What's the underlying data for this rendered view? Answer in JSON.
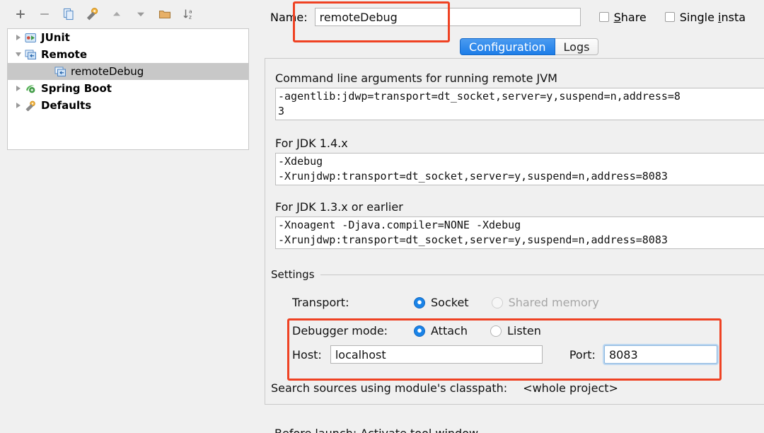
{
  "sidebar": {
    "toolbar": [
      {
        "name": "add-button",
        "icon": "plus-icon",
        "glyph": "+"
      },
      {
        "name": "remove-button",
        "icon": "minus-icon",
        "glyph": "−"
      },
      {
        "name": "copy-button",
        "icon": "copy-icon",
        "glyph": "copy"
      },
      {
        "name": "edit-defaults-button",
        "icon": "wrench-icon",
        "glyph": "wrench"
      },
      {
        "name": "move-up-button",
        "icon": "arrow-up-icon",
        "glyph": "▲"
      },
      {
        "name": "move-down-button",
        "icon": "arrow-down-icon",
        "glyph": "▼"
      },
      {
        "name": "new-folder-button",
        "icon": "folder-icon",
        "glyph": "folder"
      },
      {
        "name": "sort-alphabetically-button",
        "icon": "sort-az-icon",
        "glyph": "sort"
      }
    ],
    "tree": [
      {
        "label": "JUnit",
        "icon": "junit-icon",
        "expanded": false,
        "level": 1,
        "bold": true,
        "selected": false
      },
      {
        "label": "Remote",
        "icon": "remote-icon",
        "expanded": true,
        "level": 1,
        "bold": true,
        "selected": false
      },
      {
        "label": "remoteDebug",
        "icon": "remote-icon",
        "expanded": null,
        "level": 2,
        "bold": false,
        "selected": true
      },
      {
        "label": "Spring Boot",
        "icon": "spring-boot-icon",
        "expanded": false,
        "level": 1,
        "bold": true,
        "selected": false
      },
      {
        "label": "Defaults",
        "icon": "wrench-icon",
        "expanded": false,
        "level": 1,
        "bold": true,
        "selected": false
      }
    ]
  },
  "header": {
    "name_label": "Name:",
    "name_value": "remoteDebug",
    "name_placeholder": "",
    "share": {
      "label_pre": "",
      "label_mnemonic": "S",
      "label_post": "hare",
      "checked": false
    },
    "single_instance": {
      "label_pre": "Single ",
      "label_mnemonic": "i",
      "label_post": "nsta",
      "checked": false
    }
  },
  "tabs": [
    {
      "label": "Configuration",
      "active": true
    },
    {
      "label": "Logs",
      "active": false
    }
  ],
  "configuration": {
    "command_line": {
      "label": "Command line arguments for running remote JVM",
      "value": "-agentlib:jdwp=transport=dt_socket,server=y,suspend=n,address=8\n3"
    },
    "jdk14": {
      "label": "For JDK 1.4.x",
      "value": "-Xdebug\n-Xrunjdwp:transport=dt_socket,server=y,suspend=n,address=8083"
    },
    "jdk13": {
      "label": "For JDK 1.3.x or earlier",
      "value": "-Xnoagent -Djava.compiler=NONE -Xdebug\n-Xrunjdwp:transport=dt_socket,server=y,suspend=n,address=8083"
    },
    "settings": {
      "group_title": "Settings",
      "transport": {
        "label": "Transport:",
        "options": [
          {
            "label": "Socket",
            "selected": true,
            "disabled": false
          },
          {
            "label": "Shared memory",
            "selected": false,
            "disabled": true
          }
        ]
      },
      "debugger_mode": {
        "label": "Debugger mode:",
        "options": [
          {
            "label": "Attach",
            "selected": true,
            "disabled": false
          },
          {
            "label": "Listen",
            "selected": false,
            "disabled": false
          }
        ]
      },
      "host": {
        "label": "Host:",
        "value": "localhost"
      },
      "port": {
        "label": "Port:",
        "value": "8083",
        "focused": true
      }
    },
    "search_sources": {
      "label": "Search sources using module's classpath:",
      "value": "<whole project>"
    },
    "bottom_partial": "Before launch: Activate tool window"
  },
  "annotations": {
    "color": "#ef4223",
    "boxes": [
      {
        "name": "name-field-highlight"
      },
      {
        "name": "debugger-connection-highlight"
      }
    ]
  }
}
